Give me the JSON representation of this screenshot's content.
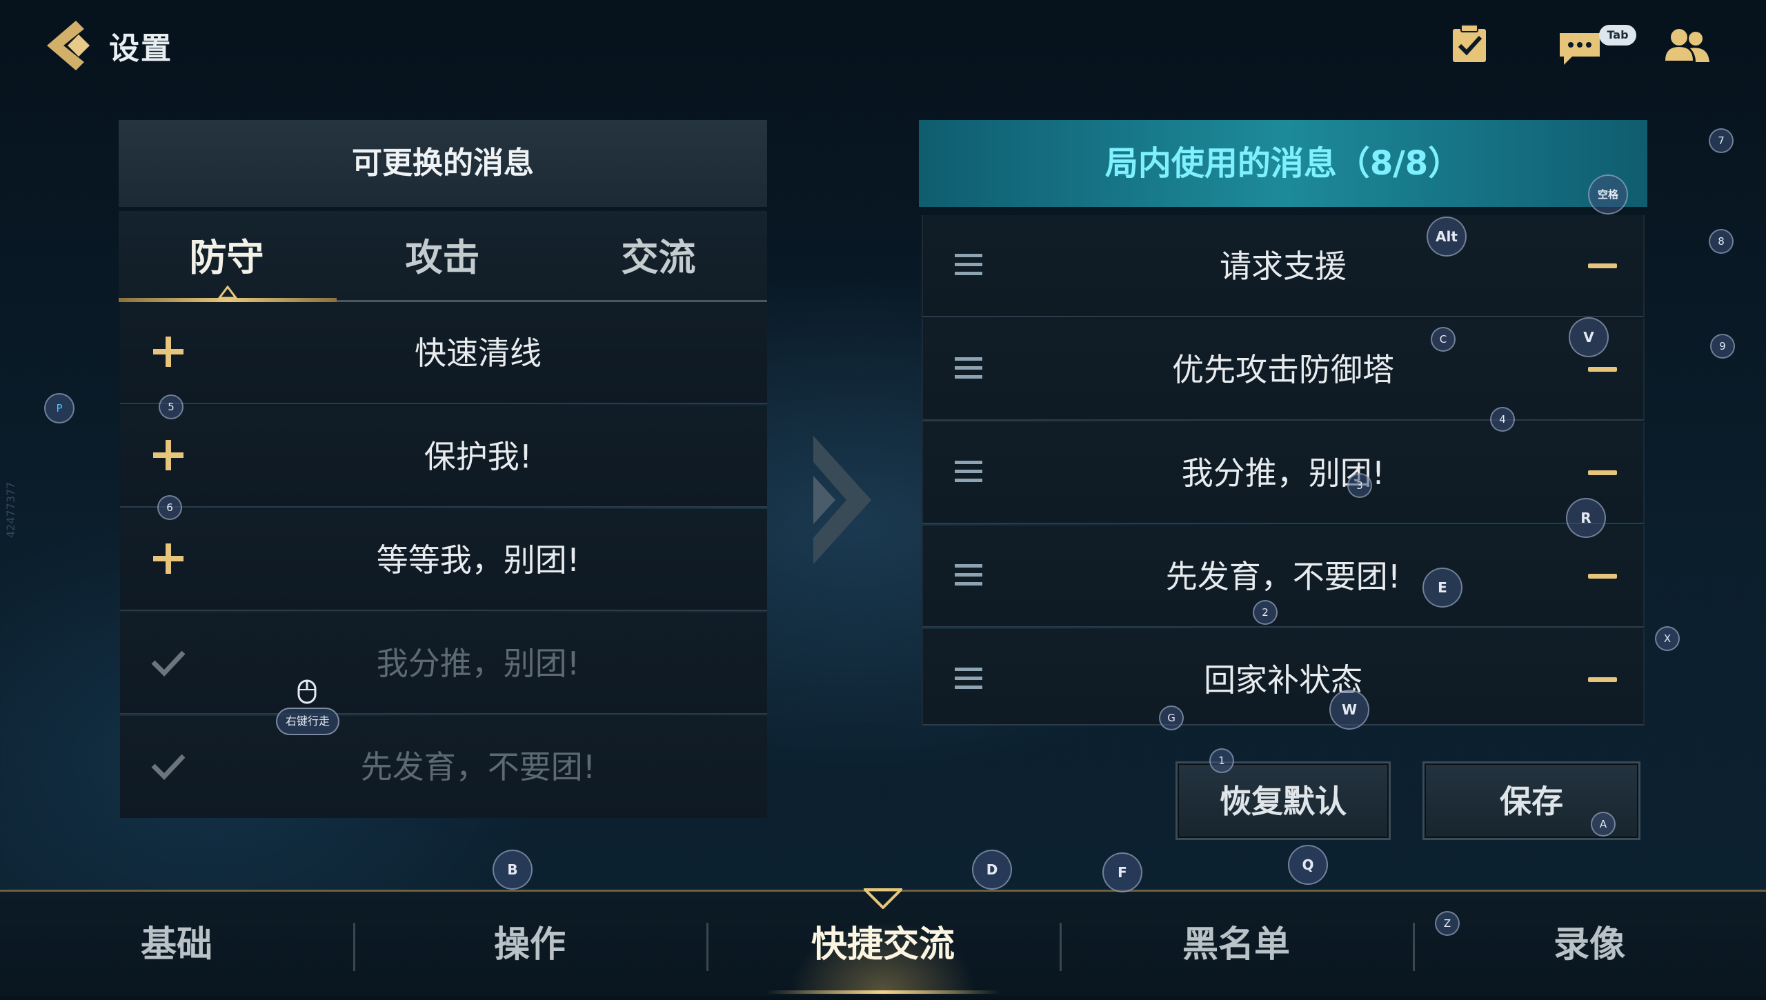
{
  "header": {
    "title": "设置",
    "tab_hint": "Tab",
    "icons": [
      "back-chevron-icon",
      "tasks-checklist-icon",
      "chat-bubble-icon",
      "friends-icon"
    ]
  },
  "left_panel": {
    "title": "可更换的消息",
    "tabs": [
      {
        "label": "防守",
        "active": true
      },
      {
        "label": "攻击",
        "active": false
      },
      {
        "label": "交流",
        "active": false
      }
    ],
    "rows": [
      {
        "text": "快速清线",
        "state": "add"
      },
      {
        "text": "保护我!",
        "state": "add"
      },
      {
        "text": "等等我，别团!",
        "state": "add"
      },
      {
        "text": "我分推，别团!",
        "state": "added"
      },
      {
        "text": "先发育，不要团!",
        "state": "added"
      }
    ]
  },
  "right_panel": {
    "title": "局内使用的消息（8/8）",
    "rows": [
      {
        "text": "请求支援"
      },
      {
        "text": "优先攻击防御塔"
      },
      {
        "text": "我分推，别团!"
      },
      {
        "text": "先发育，不要团!"
      },
      {
        "text": "回家补状态"
      }
    ],
    "restore_label": "恢复默认",
    "save_label": "保存"
  },
  "bottom_nav": {
    "items": [
      {
        "label": "基础",
        "active": false
      },
      {
        "label": "操作",
        "active": false
      },
      {
        "label": "快捷交流",
        "active": true
      },
      {
        "label": "黑名单",
        "active": false
      },
      {
        "label": "录像",
        "active": false
      }
    ]
  },
  "overlay": {
    "walk_label": "右键行走",
    "side_code": "42477377",
    "keys": {
      "p": "P",
      "k5": "5",
      "k6": "6",
      "b": "B",
      "d": "D",
      "f": "F",
      "q": "Q",
      "z": "Z",
      "x": "X",
      "a": "A",
      "k1": "1",
      "g": "G",
      "w": "W",
      "k2": "2",
      "e": "E",
      "r": "R",
      "k3": "3",
      "k4": "4",
      "c": "C",
      "v": "V",
      "alt": "Alt",
      "space": "空格",
      "k7": "7",
      "k8": "8",
      "k9": "9"
    }
  },
  "colors": {
    "accent_gold": "#e8c57c",
    "teal_header": "#1d8a9a",
    "teal_text": "#7ef0ff"
  }
}
